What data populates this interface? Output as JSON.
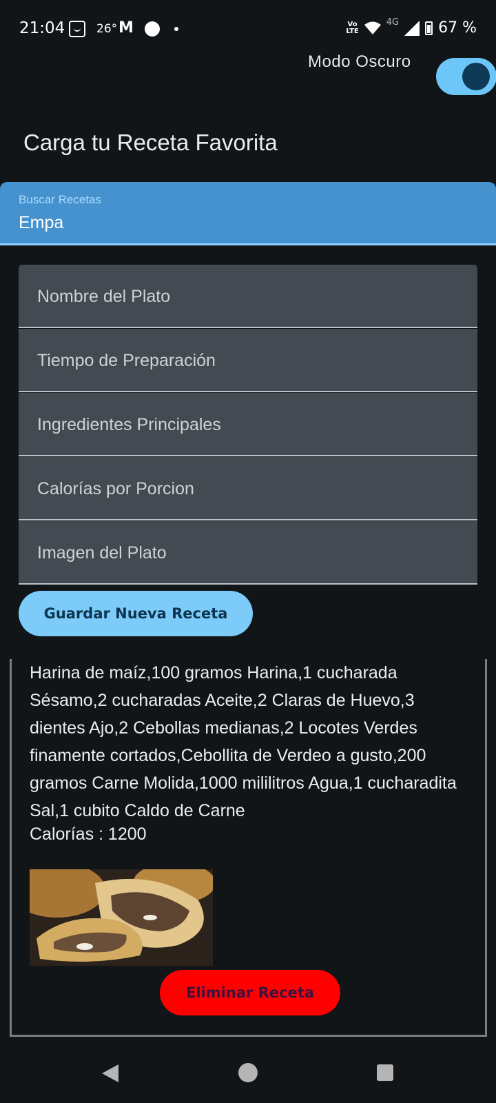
{
  "status_bar": {
    "time": "21:04",
    "temperature": "26°",
    "network": "4G",
    "volte_top": "Vo",
    "volte_bottom": "LTE",
    "battery": "67 %"
  },
  "dark_mode": {
    "label": "Modo Oscuro",
    "enabled": true
  },
  "page_title": "Carga tu Receta Favorita",
  "search": {
    "label": "Buscar Recetas",
    "value": "Empa"
  },
  "form": {
    "fields": [
      {
        "placeholder": "Nombre del Plato"
      },
      {
        "placeholder": "Tiempo de Preparación"
      },
      {
        "placeholder": "Ingredientes Principales"
      },
      {
        "placeholder": "Calorías por Porcion"
      },
      {
        "placeholder": "Imagen del Plato"
      }
    ],
    "save_label": "Guardar Nueva Receta"
  },
  "recipe": {
    "ingredients": "Harina de maíz,100 gramos Harina,1 cucharada Sésamo,2 cucharadas Aceite,2 Claras de Huevo,3 dientes Ajo,2 Cebollas medianas,2 Locotes Verdes finamente cortados,Cebollita de Verdeo a gusto,200 gramos Carne Molida,1000 mililitros Agua,1 cucharadita Sal,1 cubito Caldo de Carne",
    "calories": "Calorías : 1200",
    "delete_label": "Eliminar Receta"
  },
  "colors": {
    "background": "#111518",
    "search_bg": "#4592cf",
    "field_bg": "#434a52",
    "accent": "#7ccbf8",
    "delete": "#ff0000"
  }
}
